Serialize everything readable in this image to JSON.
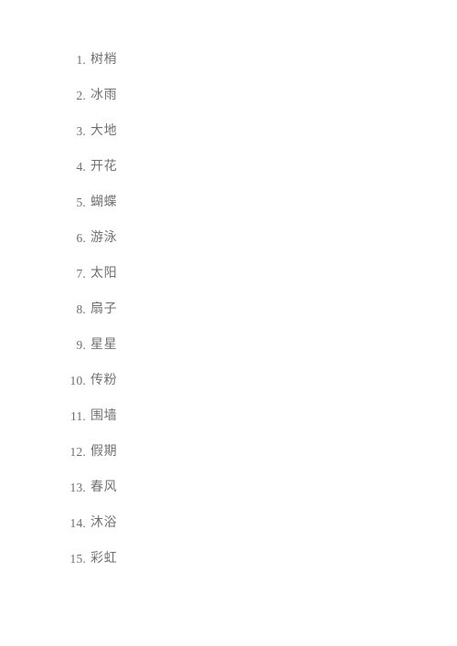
{
  "document": {
    "background_color": "#ffffff",
    "text_color": "#717171",
    "marker_color": "#6f6f6f",
    "list": {
      "type": "ordered-numeric",
      "items": [
        {
          "marker": "1.",
          "text": "树梢"
        },
        {
          "marker": "2.",
          "text": "冰雨"
        },
        {
          "marker": "3.",
          "text": "大地"
        },
        {
          "marker": "4.",
          "text": "开花"
        },
        {
          "marker": "5.",
          "text": "蝴蝶"
        },
        {
          "marker": "6.",
          "text": "游泳"
        },
        {
          "marker": "7.",
          "text": "太阳"
        },
        {
          "marker": "8.",
          "text": "扇子"
        },
        {
          "marker": "9.",
          "text": "星星"
        },
        {
          "marker": "10.",
          "text": "传粉"
        },
        {
          "marker": "11.",
          "text": "围墙"
        },
        {
          "marker": "12.",
          "text": "假期"
        },
        {
          "marker": "13.",
          "text": "春风"
        },
        {
          "marker": "14.",
          "text": "沐浴"
        },
        {
          "marker": "15.",
          "text": "彩虹"
        }
      ]
    }
  }
}
